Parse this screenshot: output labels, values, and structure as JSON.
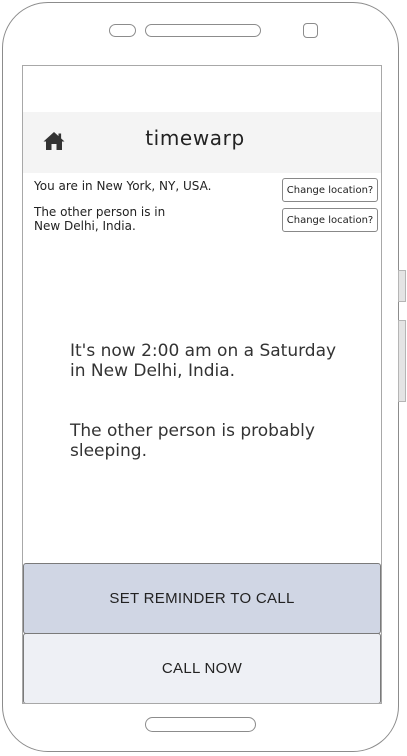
{
  "header": {
    "title": "timewarp",
    "home_icon": "home-icon"
  },
  "locations": {
    "you_text": "You are in New York, NY, USA.",
    "other_line1": "The other person is in",
    "other_line2": "New Delhi, India.",
    "change_label": "Change location?"
  },
  "message": {
    "time_line1": "It's now 2:00 am on a Saturday",
    "time_line2": "in New Delhi, India.",
    "status_line1": "The other person is probably",
    "status_line2": "sleeping."
  },
  "actions": {
    "reminder_label": "SET REMINDER TO CALL",
    "call_label": "CALL NOW"
  },
  "colors": {
    "header_bg": "#f4f4f4",
    "reminder_bg": "#d0d6e4",
    "call_bg": "#eef0f5"
  }
}
